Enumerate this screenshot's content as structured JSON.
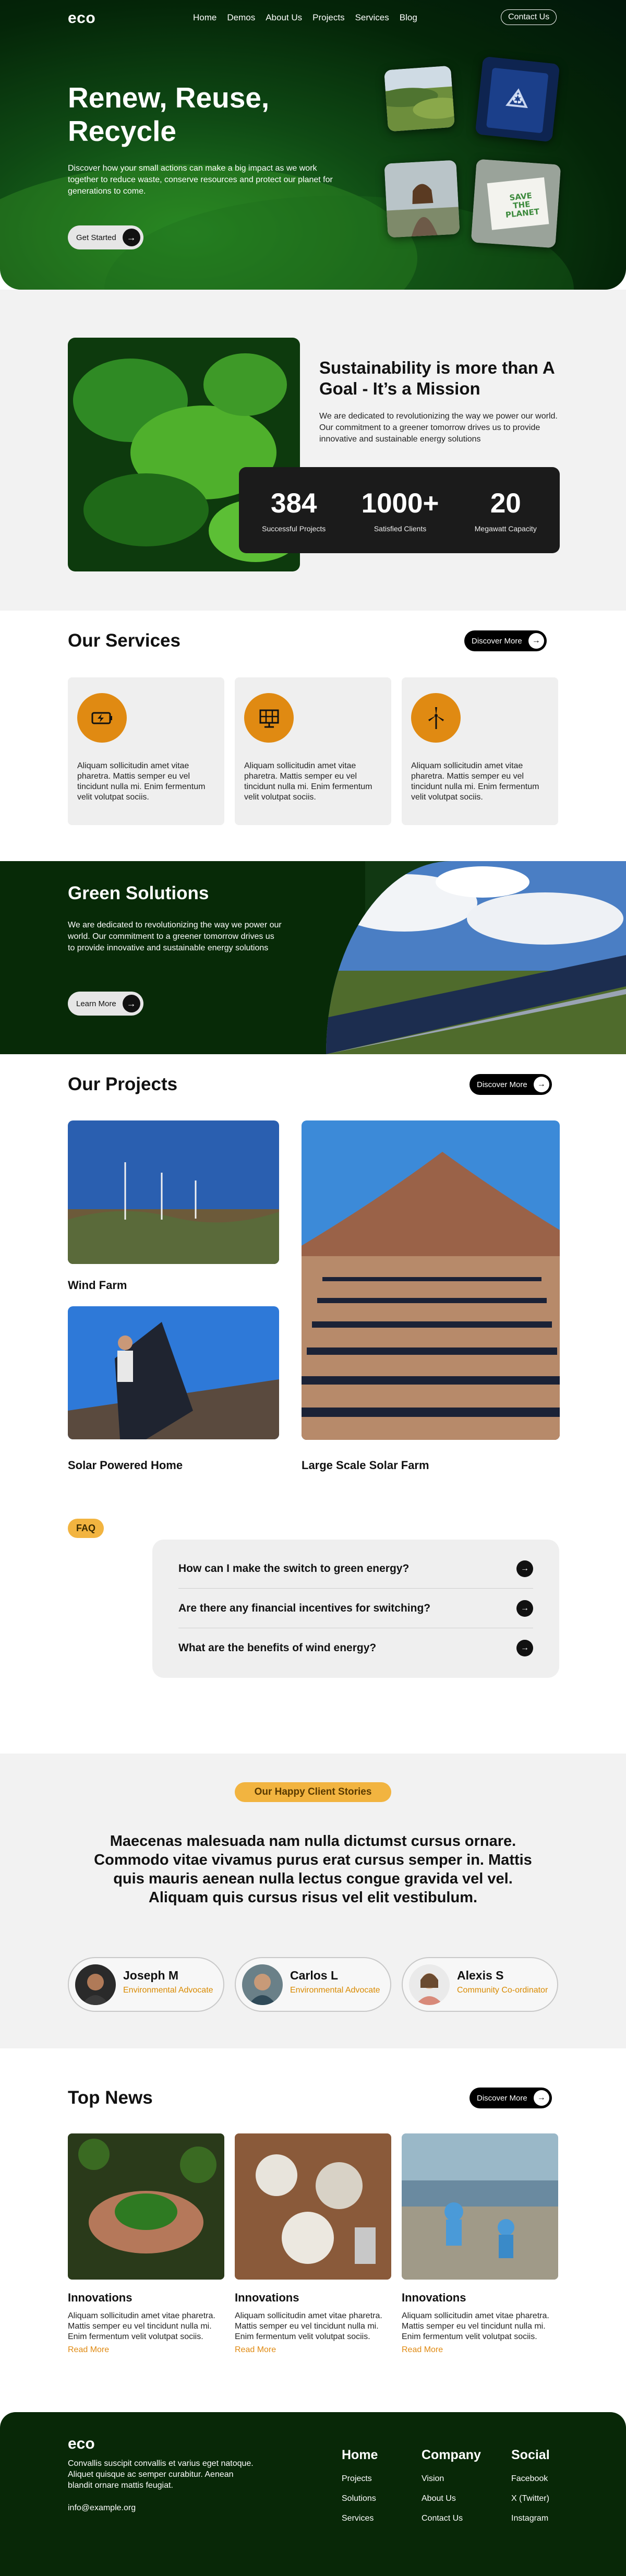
{
  "nav": {
    "logo": "eco",
    "items": [
      "Home",
      "Demos",
      "About Us",
      "Projects",
      "Services",
      "Blog"
    ],
    "contact": "Contact Us"
  },
  "hero": {
    "title": "Renew, Reuse, Recycle",
    "subtitle": "Discover how your small actions can make a big impact as we work together to reduce waste, conserve resources and protect our planet for generations to come.",
    "cta": "Get Started",
    "sign_text": "SAVE THE PLANET"
  },
  "about": {
    "title": "Sustainability is more than A Goal - It’s a Mission",
    "text": "We are dedicated to revolutionizing the way we power our world. Our commitment to a greener tomorrow drives us to provide innovative and sustainable energy solutions",
    "stats": [
      {
        "num": "384",
        "label": "Successful Projects"
      },
      {
        "num": "1000+",
        "label": "Satisfied Clients"
      },
      {
        "num": "20",
        "label": "Megawatt Capacity"
      }
    ]
  },
  "services": {
    "title": "Our Services",
    "discover": "Discover More",
    "cards": [
      {
        "icon": "battery-charging-icon",
        "text": "Aliquam sollicitudin amet vitae pharetra. Mattis semper eu vel tincidunt nulla mi. Enim fermentum velit volutpat sociis."
      },
      {
        "icon": "solar-panel-icon",
        "text": "Aliquam sollicitudin amet vitae pharetra. Mattis semper eu vel tincidunt nulla mi. Enim fermentum velit volutpat sociis."
      },
      {
        "icon": "wind-turbine-icon",
        "text": "Aliquam sollicitudin amet vitae pharetra. Mattis semper eu vel tincidunt nulla mi. Enim fermentum velit volutpat sociis."
      }
    ]
  },
  "green": {
    "title": "Green Solutions",
    "text": "We are dedicated to revolutionizing the way we power our world. Our commitment to a greener tomorrow drives us to provide innovative and sustainable energy solutions",
    "cta": "Learn More"
  },
  "projects": {
    "title": "Our Projects",
    "discover": "Discover More",
    "items": [
      "Wind Farm",
      "Solar Powered Home",
      "Large Scale Solar Farm"
    ]
  },
  "faq": {
    "tag": "FAQ",
    "questions": [
      "How can I make the switch to green energy?",
      "Are there any financial incentives for switching?",
      "What are the benefits of wind energy?"
    ]
  },
  "testimonials": {
    "tag": "Our Happy Client Stories",
    "quote": "Maecenas malesuada nam nulla dictumst cursus ornare. Commodo vitae vivamus purus erat cursus semper in. Mattis quis mauris aenean nulla lectus congue gravida vel vel. Aliquam quis cursus risus vel elit vestibulum.",
    "people": [
      {
        "name": "Joseph M",
        "role": "Environmental Advocate"
      },
      {
        "name": "Carlos L",
        "role": "Environmental Advocate"
      },
      {
        "name": "Alexis S",
        "role": "Community Co-ordinator"
      }
    ]
  },
  "news": {
    "title": "Top News",
    "discover": "Discover More",
    "cards": [
      {
        "title": "Innovations",
        "text": "Aliquam sollicitudin amet vitae pharetra. Mattis semper eu vel tincidunt nulla mi. Enim fermentum velit volutpat sociis.",
        "link": "Read More"
      },
      {
        "title": "Innovations",
        "text": "Aliquam sollicitudin amet vitae pharetra. Mattis semper eu vel tincidunt nulla mi. Enim fermentum velit volutpat sociis.",
        "link": "Read More"
      },
      {
        "title": "Innovations",
        "text": "Aliquam sollicitudin amet vitae pharetra. Mattis semper eu vel tincidunt nulla mi. Enim fermentum velit volutpat sociis.",
        "link": "Read More"
      }
    ]
  },
  "footer": {
    "logo": "eco",
    "desc": "Convallis suscipit convallis et varius eget natoque. Aliquet quisque ac semper curabitur. Aenean blandit ornare mattis feugiat.",
    "email": "info@example.org",
    "cols": [
      {
        "title": "Home",
        "links": [
          "Projects",
          "Solutions",
          "Services"
        ]
      },
      {
        "title": "Company",
        "links": [
          "Vision",
          "About Us",
          "Contact Us"
        ]
      },
      {
        "title": "Social",
        "links": [
          "Facebook",
          "X (Twitter)",
          "Instagram"
        ]
      }
    ]
  },
  "colors": {
    "accent": "#e08a12",
    "tag": "#f2b440",
    "dark_green": "#072a07"
  }
}
